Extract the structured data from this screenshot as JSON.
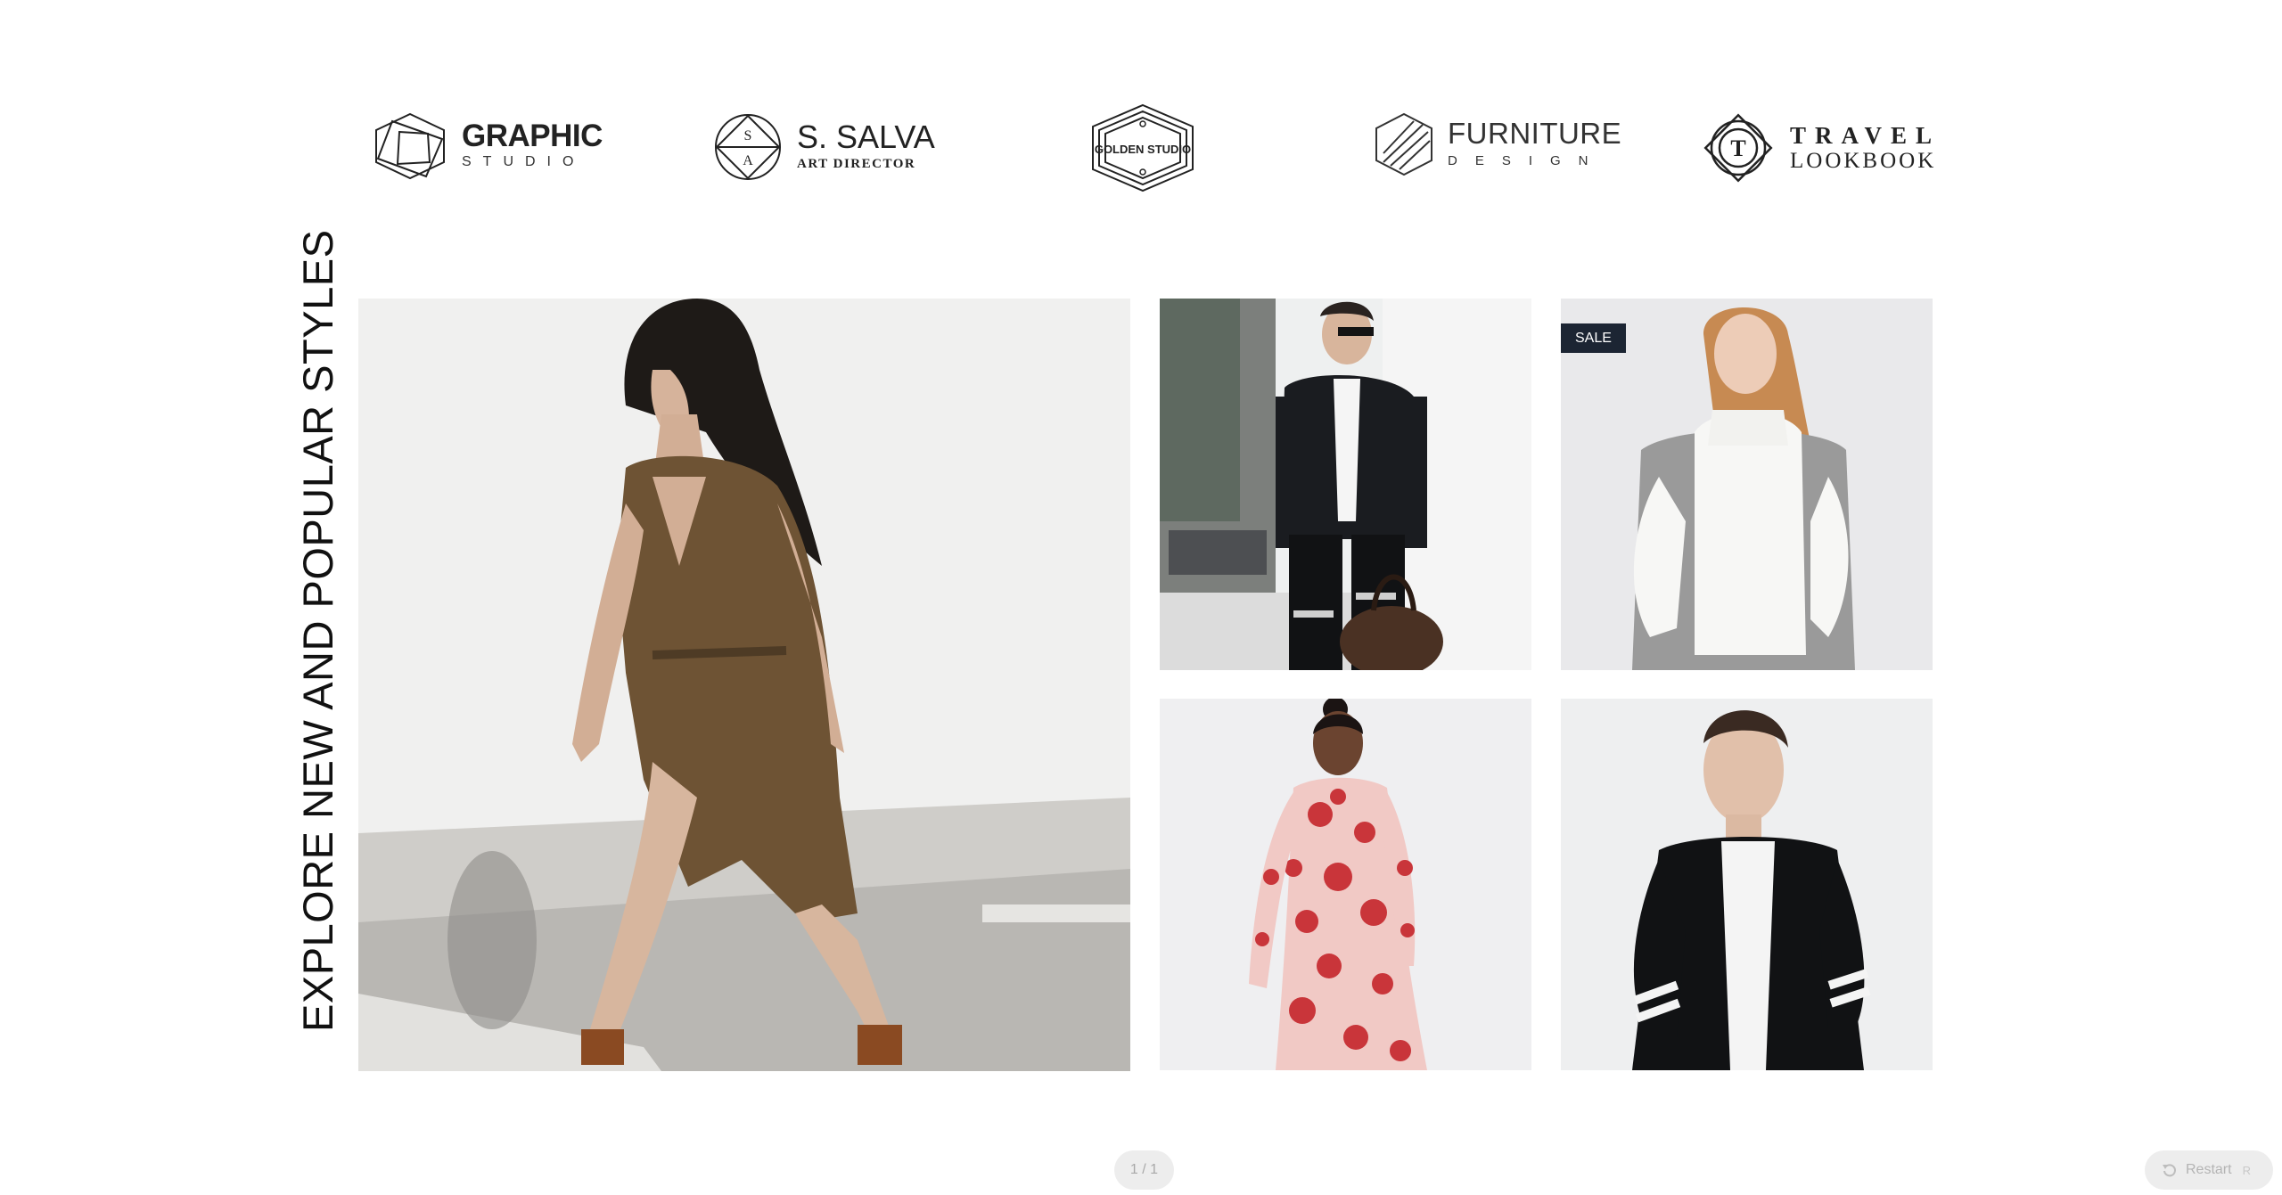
{
  "logos": [
    {
      "name": "graphic-studio",
      "line1": "GRAPHIC",
      "line2": "STUDIO"
    },
    {
      "name": "s-salva",
      "line1": "S. SALVA",
      "line2": "ART DIRECTOR",
      "emblem": [
        "S",
        "A"
      ]
    },
    {
      "name": "golden-studio",
      "line1": "GOLDEN STUDIO"
    },
    {
      "name": "furniture-design",
      "line1": "FURNITURE",
      "line2": "DESIGN"
    },
    {
      "name": "travel-lookbook",
      "line1": "TRAVEL",
      "line2": "LOOKBOOK",
      "emblem": "T"
    }
  ],
  "section": {
    "title": "EXPLORE NEW AND POPULAR STYLES"
  },
  "products": [
    {
      "id": "hero",
      "image": "woman-walking-olive-wrap-dress"
    },
    {
      "id": "tile-1",
      "image": "man-black-military-jacket-with-bag"
    },
    {
      "id": "tile-2",
      "image": "woman-white-turtleneck-grey-vest",
      "badge": "SALE"
    },
    {
      "id": "tile-3",
      "image": "woman-red-floral-dress"
    },
    {
      "id": "tile-4",
      "image": "man-black-cable-knit-cardigan"
    }
  ],
  "controls": {
    "pager": "1 / 1",
    "restart_label": "Restart",
    "restart_shortcut": "R"
  },
  "colors": {
    "badge_bg": "#1c2533",
    "control_bg": "#ededed",
    "control_text": "#a9a9a9"
  }
}
